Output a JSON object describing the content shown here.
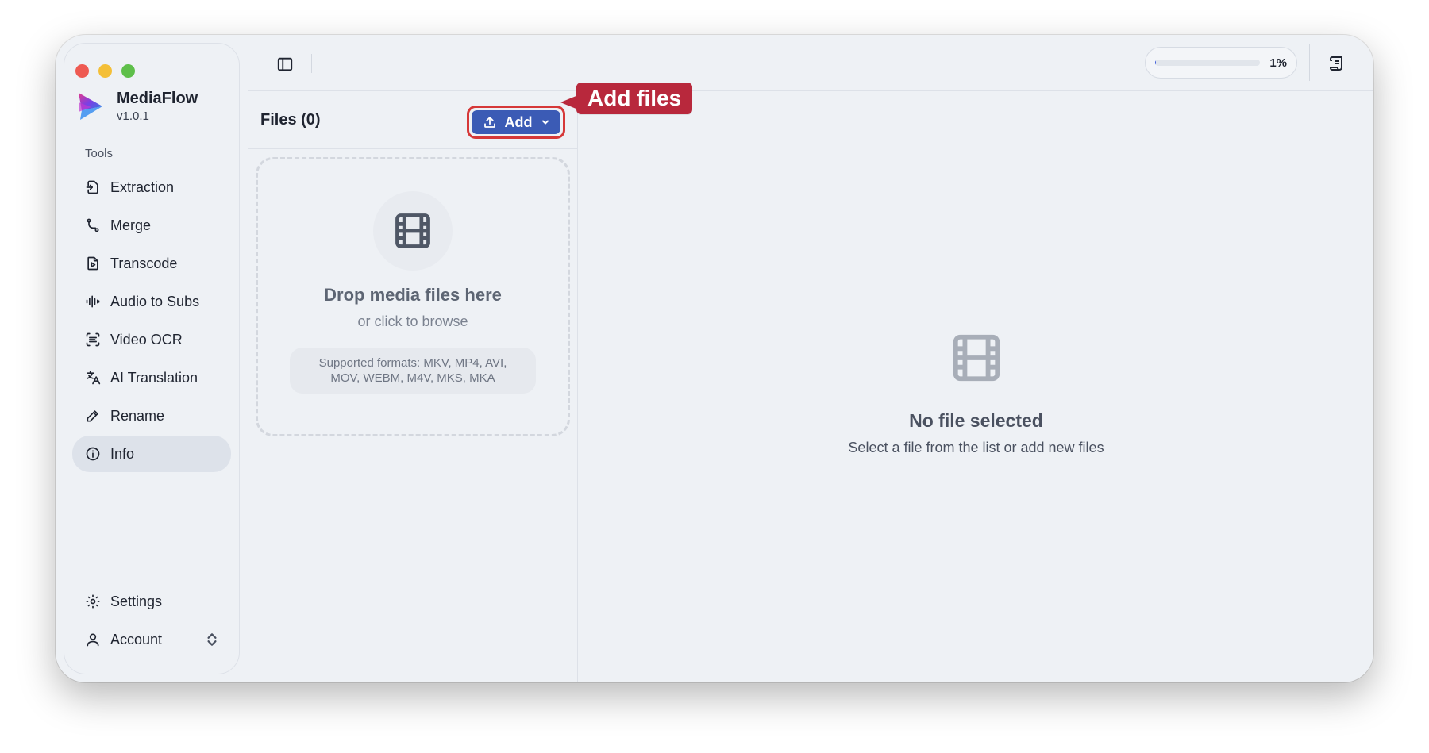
{
  "app": {
    "name": "MediaFlow",
    "version": "v1.0.1"
  },
  "sidebar": {
    "section_label": "Tools",
    "items": [
      {
        "label": "Extraction",
        "icon": "file-export-icon"
      },
      {
        "label": "Merge",
        "icon": "merge-icon"
      },
      {
        "label": "Transcode",
        "icon": "file-play-icon"
      },
      {
        "label": "Audio to Subs",
        "icon": "audio-waveform-icon"
      },
      {
        "label": "Video OCR",
        "icon": "scan-text-icon"
      },
      {
        "label": "AI Translation",
        "icon": "languages-icon"
      },
      {
        "label": "Rename",
        "icon": "pencil-icon"
      },
      {
        "label": "Info",
        "icon": "info-icon",
        "active": true
      }
    ],
    "bottom": [
      {
        "label": "Settings",
        "icon": "gear-icon"
      },
      {
        "label": "Account",
        "icon": "user-icon"
      }
    ]
  },
  "topbar": {
    "progress_percent": 1,
    "progress_label": "1%"
  },
  "files": {
    "title": "Files (0)",
    "add_label": "Add",
    "drop_title": "Drop media files here",
    "drop_sub": "or click to browse",
    "formats": "Supported formats: MKV, MP4, AVI, MOV, WEBM, M4V, MKS, MKA"
  },
  "detail": {
    "empty_title": "No file selected",
    "empty_sub": "Select a file from the list or add new files"
  },
  "annotation": {
    "label": "Add files",
    "color": "#b8283c"
  },
  "colors": {
    "accent": "#3b5bb5",
    "highlight": "#d63838"
  }
}
